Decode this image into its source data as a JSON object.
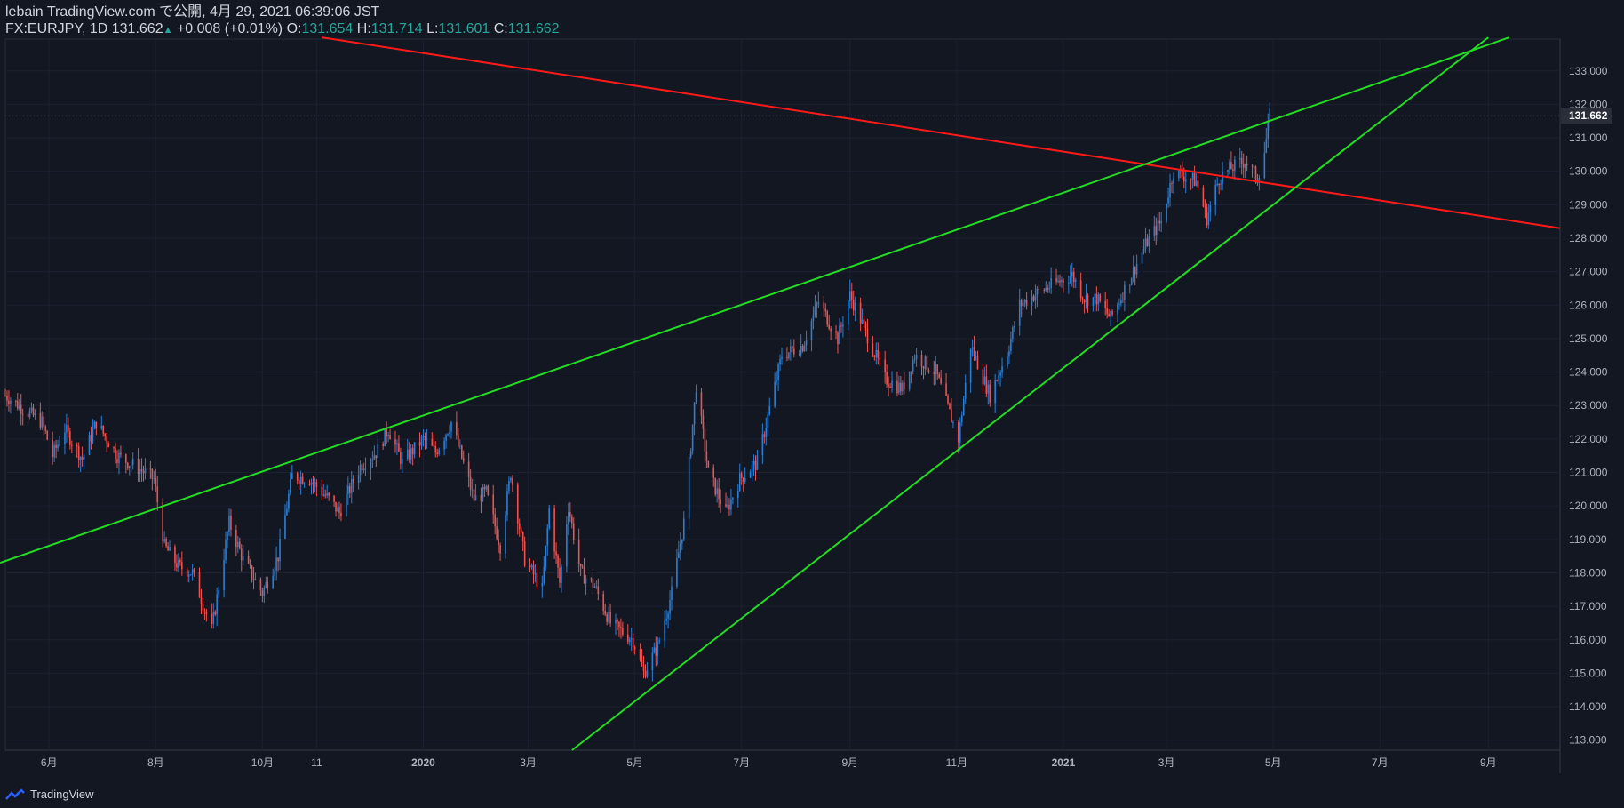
{
  "header": {
    "publisher_line": "lebain TradingView.com で公開, 4月 29, 2021 06:39:06 JST",
    "symbol": "FX:EURJPY, 1D",
    "last_price": "131.662",
    "change_arrow": "▲",
    "change": "+0.008 (+0.01%)",
    "o_label": "O:",
    "o_value": "131.654",
    "h_label": "H:",
    "h_value": "131.714",
    "l_label": "L:",
    "l_value": "131.601",
    "c_label": "C:",
    "c_value": "131.662"
  },
  "footer": {
    "brand": "TradingView",
    "logo_icon": "tradingview-logo-icon"
  },
  "colors": {
    "background": "#131722",
    "up_candle": "#2a7fd6",
    "down_candle": "#ef5350",
    "red_trendline": "#ff1a1a",
    "green_trendline": "#22dd22",
    "price_label_bg": "#2a2e39",
    "up_text": "#26a69a"
  },
  "chart_data": {
    "type": "candlestick",
    "symbol": "FX:EURJPY",
    "interval": "1D",
    "y_axis": {
      "min": 112.7,
      "max": 133.95,
      "ticks": [
        "113.000",
        "114.000",
        "115.000",
        "116.000",
        "117.000",
        "118.000",
        "119.000",
        "120.000",
        "121.000",
        "122.000",
        "123.000",
        "124.000",
        "125.000",
        "126.000",
        "127.000",
        "128.000",
        "129.000",
        "130.000",
        "131.000",
        "132.000",
        "133.000"
      ],
      "current_price_label": "131.662"
    },
    "x_axis": {
      "start": "2019-05-07",
      "end": "2021-10-12",
      "ticks": [
        {
          "label": "6月",
          "date": "2019-06-01"
        },
        {
          "label": "8月",
          "date": "2019-08-01"
        },
        {
          "label": "10月",
          "date": "2019-10-01"
        },
        {
          "label": "11",
          "date": "2019-11-01"
        },
        {
          "label": "2020",
          "date": "2020-01-01"
        },
        {
          "label": "3月",
          "date": "2020-03-01"
        },
        {
          "label": "5月",
          "date": "2020-05-01"
        },
        {
          "label": "7月",
          "date": "2020-07-01"
        },
        {
          "label": "9月",
          "date": "2020-09-01"
        },
        {
          "label": "11月",
          "date": "2020-11-01"
        },
        {
          "label": "2021",
          "date": "2021-01-01"
        },
        {
          "label": "3月",
          "date": "2021-03-01"
        },
        {
          "label": "5月",
          "date": "2021-05-01"
        },
        {
          "label": "7月",
          "date": "2021-07-01"
        },
        {
          "label": "9月",
          "date": "2021-09-01"
        }
      ]
    },
    "price_path": [
      [
        "2019-05-07",
        123.3
      ],
      [
        "2019-05-20",
        122.8
      ],
      [
        "2019-05-28",
        122.5
      ],
      [
        "2019-06-03",
        121.5
      ],
      [
        "2019-06-10",
        122.3
      ],
      [
        "2019-06-20",
        121.4
      ],
      [
        "2019-06-28",
        122.5
      ],
      [
        "2019-07-10",
        121.5
      ],
      [
        "2019-07-20",
        121.2
      ],
      [
        "2019-07-31",
        120.8
      ],
      [
        "2019-08-06",
        118.8
      ],
      [
        "2019-08-14",
        118.2
      ],
      [
        "2019-08-22",
        118.0
      ],
      [
        "2019-09-02",
        116.3
      ],
      [
        "2019-09-12",
        119.5
      ],
      [
        "2019-09-20",
        118.4
      ],
      [
        "2019-10-01",
        117.4
      ],
      [
        "2019-10-10",
        118.5
      ],
      [
        "2019-10-18",
        120.9
      ],
      [
        "2019-10-28",
        120.8
      ],
      [
        "2019-11-08",
        120.2
      ],
      [
        "2019-11-14",
        119.8
      ],
      [
        "2019-11-26",
        121.2
      ],
      [
        "2019-12-05",
        121.6
      ],
      [
        "2019-12-12",
        122.3
      ],
      [
        "2019-12-20",
        121.3
      ],
      [
        "2020-01-01",
        122.0
      ],
      [
        "2020-01-08",
        121.6
      ],
      [
        "2020-01-17",
        122.5
      ],
      [
        "2020-01-30",
        120.2
      ],
      [
        "2020-02-06",
        120.4
      ],
      [
        "2020-02-14",
        118.8
      ],
      [
        "2020-02-20",
        121.0
      ],
      [
        "2020-02-28",
        118.4
      ],
      [
        "2020-03-09",
        117.5
      ],
      [
        "2020-03-13",
        119.9
      ],
      [
        "2020-03-19",
        117.7
      ],
      [
        "2020-03-24",
        120.0
      ],
      [
        "2020-03-31",
        118.0
      ],
      [
        "2020-04-08",
        117.6
      ],
      [
        "2020-04-17",
        116.5
      ],
      [
        "2020-04-30",
        116.0
      ],
      [
        "2020-05-06",
        115.0
      ],
      [
        "2020-05-14",
        115.8
      ],
      [
        "2020-05-22",
        117.4
      ],
      [
        "2020-05-29",
        119.5
      ],
      [
        "2020-06-05",
        123.6
      ],
      [
        "2020-06-12",
        121.0
      ],
      [
        "2020-06-22",
        119.8
      ],
      [
        "2020-06-30",
        120.8
      ],
      [
        "2020-07-10",
        121.3
      ],
      [
        "2020-07-24",
        124.5
      ],
      [
        "2020-08-05",
        124.8
      ],
      [
        "2020-08-14",
        126.1
      ],
      [
        "2020-08-25",
        125.0
      ],
      [
        "2020-09-01",
        126.3
      ],
      [
        "2020-09-10",
        125.2
      ],
      [
        "2020-09-21",
        123.8
      ],
      [
        "2020-10-01",
        123.5
      ],
      [
        "2020-10-08",
        124.5
      ],
      [
        "2020-10-20",
        124.0
      ],
      [
        "2020-11-02",
        122.0
      ],
      [
        "2020-11-09",
        124.8
      ],
      [
        "2020-11-20",
        123.3
      ],
      [
        "2020-11-30",
        124.6
      ],
      [
        "2020-12-07",
        126.0
      ],
      [
        "2020-12-18",
        126.4
      ],
      [
        "2021-01-06",
        126.9
      ],
      [
        "2021-01-13",
        126.2
      ],
      [
        "2021-01-20",
        126.2
      ],
      [
        "2021-01-28",
        125.6
      ],
      [
        "2021-02-08",
        126.8
      ],
      [
        "2021-02-18",
        127.9
      ],
      [
        "2021-02-26",
        128.5
      ],
      [
        "2021-03-05",
        130.0
      ],
      [
        "2021-03-18",
        129.7
      ],
      [
        "2021-03-24",
        128.6
      ],
      [
        "2021-03-31",
        129.8
      ],
      [
        "2021-04-07",
        130.1
      ],
      [
        "2021-04-15",
        130.3
      ],
      [
        "2021-04-22",
        129.8
      ],
      [
        "2021-04-26",
        130.6
      ],
      [
        "2021-04-29",
        131.66
      ]
    ],
    "trendlines": [
      {
        "color": "red",
        "from": [
          "2019-11-04",
          134.0
        ],
        "to": [
          "2021-10-12",
          128.3
        ]
      },
      {
        "color": "green",
        "from": [
          "2019-05-04",
          118.3
        ],
        "to": [
          "2021-09-13",
          134.0
        ]
      },
      {
        "color": "green",
        "from": [
          "2020-03-26",
          112.7
        ],
        "to": [
          "2021-09-01",
          134.0
        ]
      }
    ]
  }
}
